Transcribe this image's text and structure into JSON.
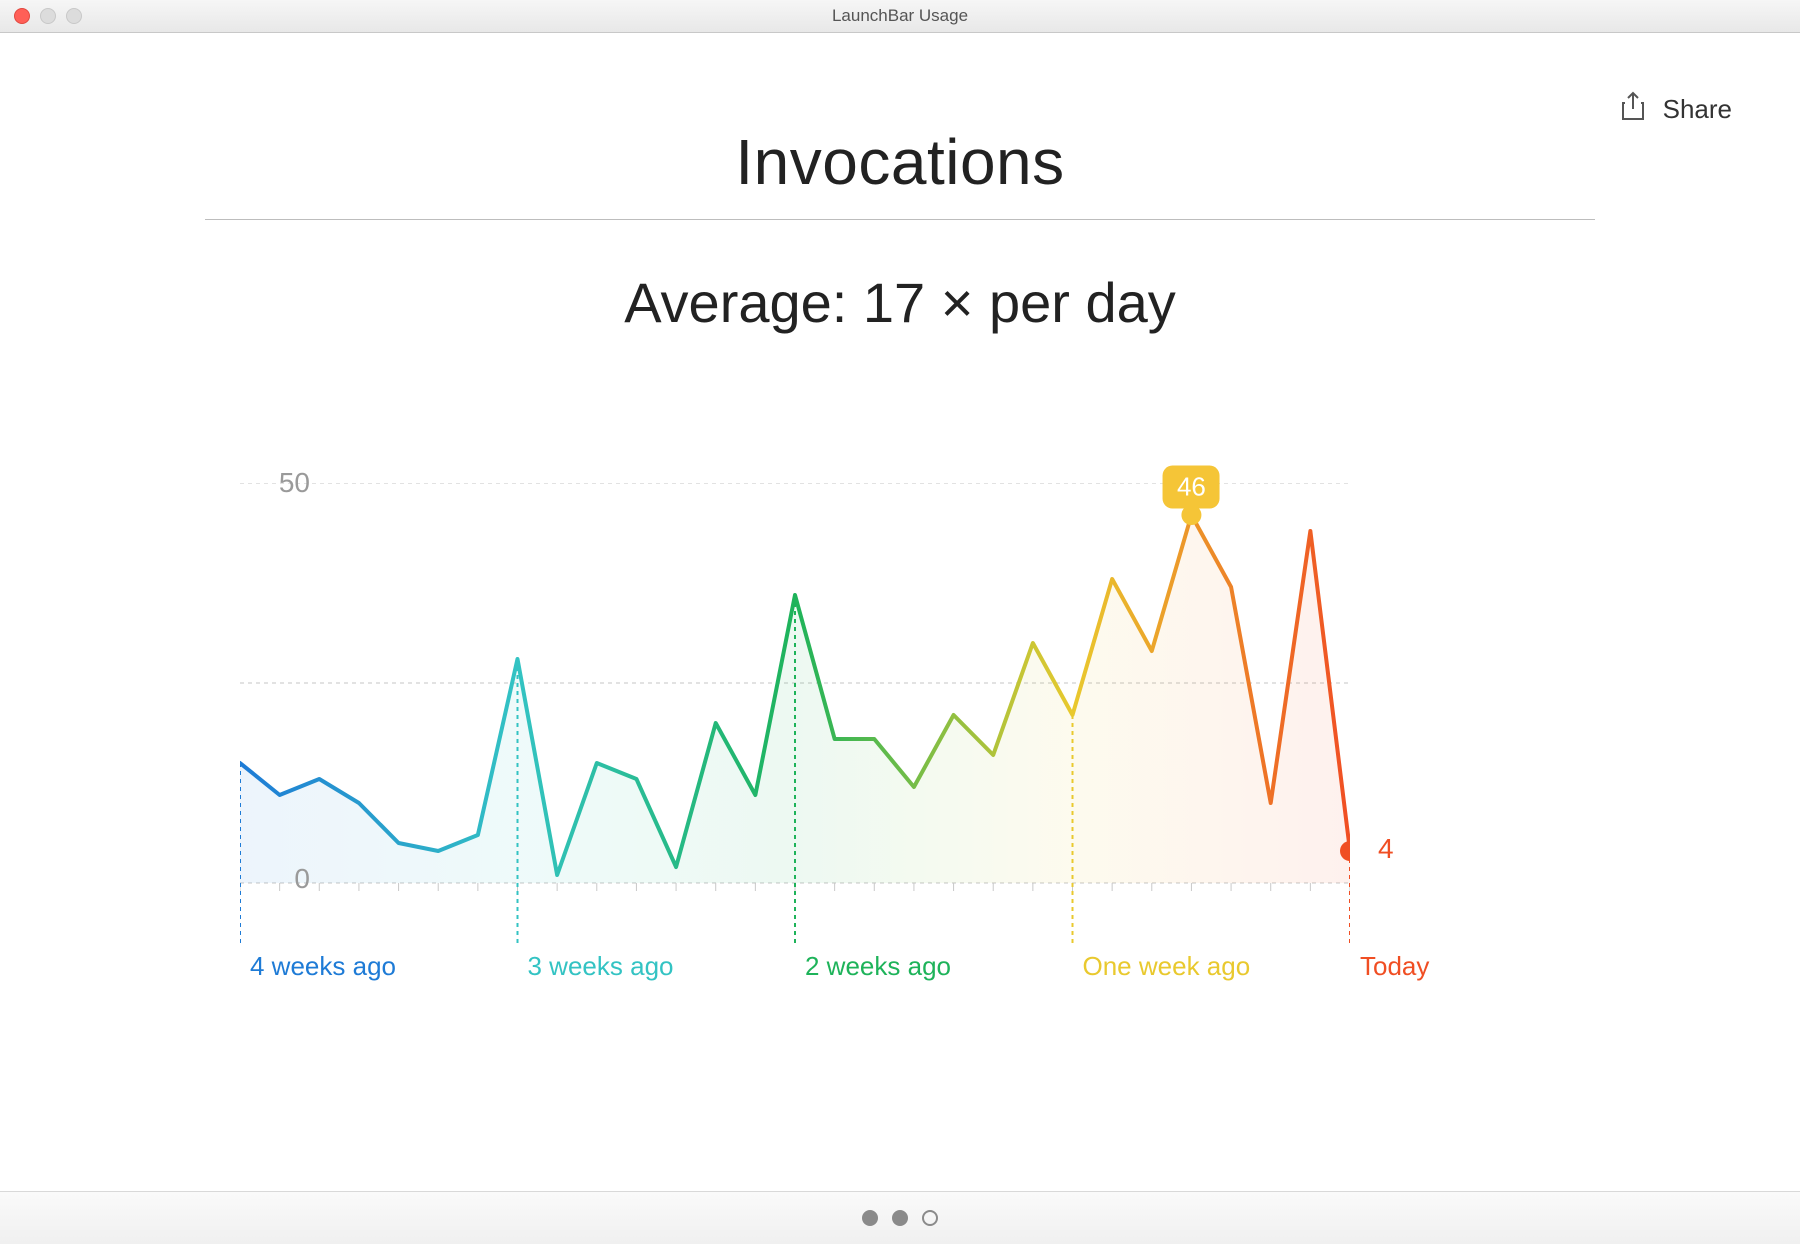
{
  "window": {
    "title": "LaunchBar Usage"
  },
  "toolbar": {
    "share_label": "Share"
  },
  "page": {
    "title": "Invocations",
    "average_label": "Average: 17 × per day"
  },
  "pager": {
    "count": 3,
    "selected": 2
  },
  "chart_data": {
    "type": "line",
    "title": "Invocations",
    "ylabel": "",
    "xlabel": "",
    "ylim": [
      0,
      50
    ],
    "yticks": [
      0,
      50
    ],
    "x_markers": [
      {
        "index": 0,
        "label": "4 weeks ago",
        "color": "#1e7bd6"
      },
      {
        "index": 7,
        "label": "3 weeks ago",
        "color": "#33c3c3"
      },
      {
        "index": 14,
        "label": "2 weeks ago",
        "color": "#1eb35a"
      },
      {
        "index": 21,
        "label": "One week ago",
        "color": "#e9c92e"
      },
      {
        "index": 28,
        "label": "Today",
        "color": "#f04e23"
      }
    ],
    "values": [
      15,
      11,
      13,
      10,
      5,
      4,
      6,
      28,
      1,
      15,
      13,
      2,
      20,
      11,
      36,
      18,
      18,
      12,
      21,
      16,
      30,
      21,
      38,
      29,
      46,
      37,
      10,
      44,
      4
    ],
    "callout": {
      "index": 24,
      "value": 46,
      "color": "#f5c537"
    },
    "end_point": {
      "index": 28,
      "value": 4,
      "color": "#f04e23"
    },
    "gradient_stops": [
      {
        "pct": 0,
        "color": "#1e7bd6"
      },
      {
        "pct": 25,
        "color": "#33c3c3"
      },
      {
        "pct": 50,
        "color": "#1eb35a"
      },
      {
        "pct": 75,
        "color": "#e9c92e"
      },
      {
        "pct": 100,
        "color": "#f04e23"
      }
    ]
  }
}
